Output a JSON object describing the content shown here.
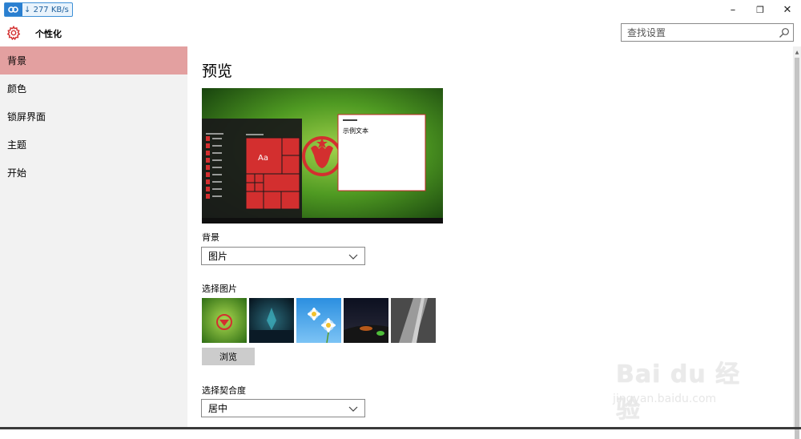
{
  "netspeed": {
    "value": "277 KB/s",
    "arrow": "↓"
  },
  "window": {
    "min_glyph": "–",
    "restore_glyph": "❐",
    "close_glyph": "✕"
  },
  "header": {
    "title": "个性化",
    "search_placeholder": "查找设置"
  },
  "sidebar": {
    "items": [
      {
        "label": "背景",
        "active": true
      },
      {
        "label": "颜色",
        "active": false
      },
      {
        "label": "锁屏界面",
        "active": false
      },
      {
        "label": "主题",
        "active": false
      },
      {
        "label": "开始",
        "active": false
      }
    ]
  },
  "main": {
    "heading": "预览",
    "preview": {
      "tile_text": "Aa",
      "sample_text": "示例文本"
    },
    "background": {
      "label": "背景",
      "value": "图片"
    },
    "choose_picture": {
      "label": "选择图片",
      "browse_label": "浏览"
    },
    "fit": {
      "label": "选择契合度",
      "value": "居中"
    }
  },
  "watermark": {
    "brand": "Bai du 经验",
    "url": "jingyan.baidu.com"
  },
  "colors": {
    "accent": "#d32f2f",
    "nav_active": "#e3a0a0"
  }
}
